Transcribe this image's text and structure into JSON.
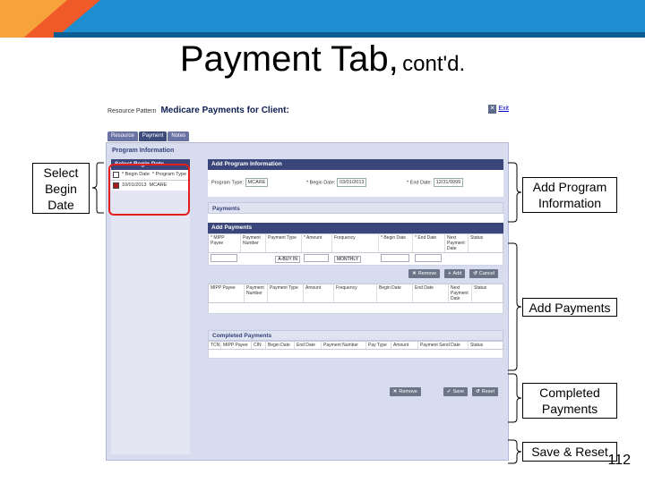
{
  "slide": {
    "title_main": "Payment Tab,",
    "title_sub": "cont'd.",
    "page_number": "112",
    "colors": {
      "blue_band": "#1f8ed0",
      "orange_accent": "#f05a28"
    }
  },
  "screen": {
    "breadcrumb": "Resource Pattern",
    "page_heading": "Medicare Payments for Client:",
    "exit_icon": "exit-icon",
    "exit_label": "Exit",
    "tabs": [
      "Resource",
      "Payment",
      "Notes"
    ],
    "section_title": "Program Information",
    "select_begin": {
      "header": "Select Begin Date",
      "col1": "* Begin Date",
      "col2": "* Program Type",
      "row": {
        "begin": "10/01/2013",
        "type": "MCARE"
      }
    },
    "add_program": {
      "header": "Add Program Information",
      "program_type_label": "Program Type:",
      "program_type_value": "MCARE",
      "begin_label": "* Begin Date:",
      "begin_value": "03/01/2013",
      "end_label": "* End Date:",
      "end_value": "12/31/9999"
    },
    "payments_title": "Payments",
    "add_payments": {
      "header": "Add Payments",
      "columns": [
        "* MIPP Payee",
        "Payment Number",
        "Payment Type",
        "* Amount",
        "Frequency",
        "* Begin Date",
        "* End Date",
        "Next Payment Date",
        "Status"
      ],
      "select_type": "A-BUY IN",
      "select_freq": "MONTHLY",
      "buttons": [
        "Remove",
        "Add",
        "Cancel"
      ]
    },
    "payments_grid": {
      "columns": [
        "MIPP Payee",
        "Payment Number",
        "Payment Type",
        "Amount",
        "Frequency",
        "Begin Date",
        "End Date",
        "Next Payment Date",
        "Status"
      ]
    },
    "completed": {
      "header": "Completed Payments",
      "columns": [
        "TCN",
        "MIPP Payee",
        "CIN",
        "Begin Date",
        "End Date",
        "Payment Number",
        "Pay Type",
        "Amount",
        "Payment Send Date",
        "Status"
      ]
    },
    "bottom_buttons": [
      "Remove",
      "Save",
      "Reset"
    ]
  },
  "callouts": {
    "select_begin": "Select Begin Date",
    "add_program": "Add Program Information",
    "add_payments": "Add Payments",
    "completed": "Completed Payments",
    "save_reset": "Save & Reset"
  }
}
